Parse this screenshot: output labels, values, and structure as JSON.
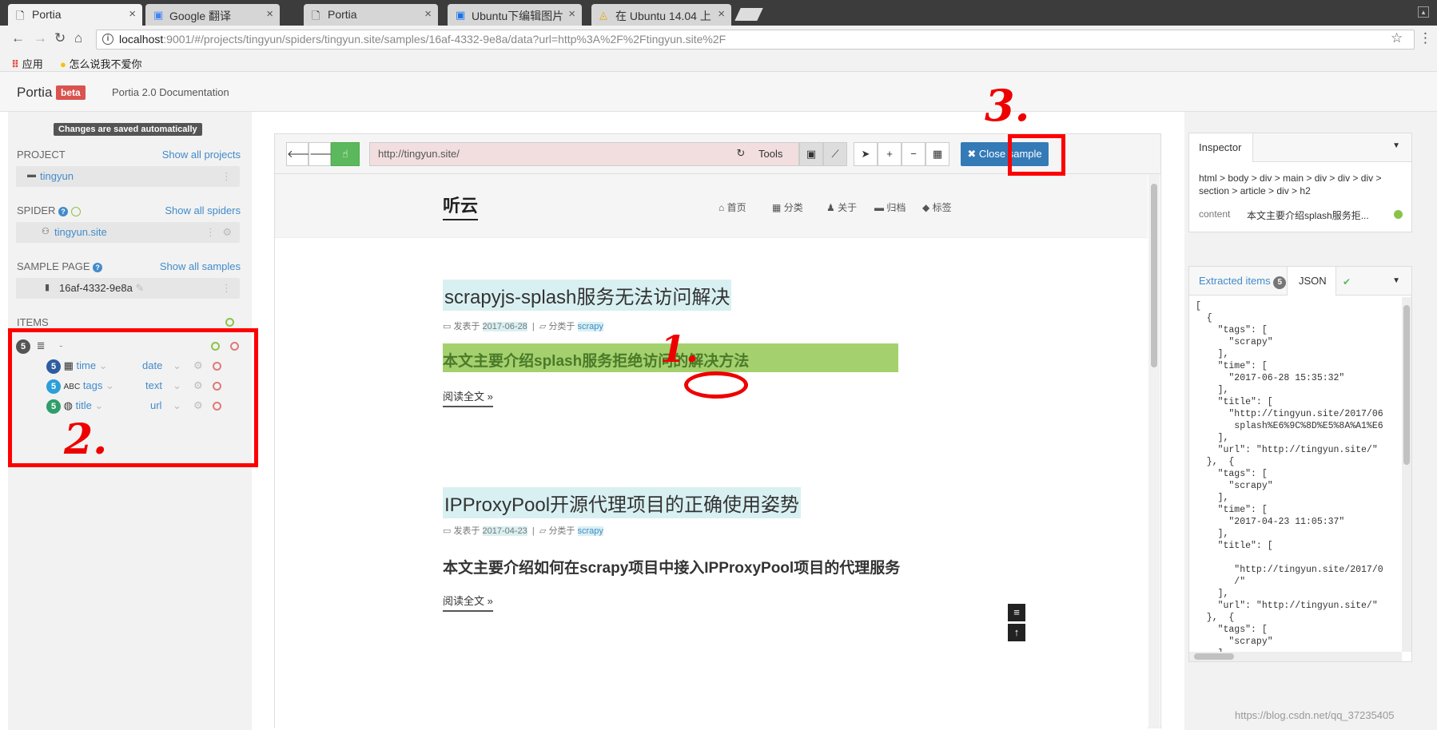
{
  "browser": {
    "tabs": [
      {
        "title": "Portia",
        "icon": "page-icon"
      },
      {
        "title": "Google 翻译",
        "icon": "google-translate-icon"
      },
      {
        "title": "Portia",
        "icon": "page-icon"
      },
      {
        "title": "Ubuntu下编辑图片",
        "icon": "ubuntu-icon"
      },
      {
        "title": "在 Ubuntu 14.04 上",
        "icon": "linux-icon"
      }
    ],
    "url_host": "localhost",
    "url_rest": ":9001/#/projects/tingyun/spiders/tingyun.site/samples/16af-4332-9e8a/data?url=http%3A%2F%2Ftingyun.site%2F",
    "bookmarks": [
      "应用",
      "怎么说我不爱你"
    ]
  },
  "portia": {
    "logo": "Portia",
    "beta": "beta",
    "doc_link": "Portia 2.0 Documentation"
  },
  "sidebar": {
    "saved_notice": "Changes are saved automatically",
    "project_label": "PROJECT",
    "project_link": "Show all projects",
    "project_name": "tingyun",
    "spider_label": "SPIDER",
    "spider_link": "Show all spiders",
    "spider_name": "tingyun.site",
    "sample_label": "SAMPLE PAGE",
    "sample_link": "Show all samples",
    "sample_name": "16af-4332-9e8a",
    "items_label": "ITEMS",
    "item_root": {
      "count": "5",
      "name": "-"
    },
    "fields": [
      {
        "count": "5",
        "icon": "calendar-icon",
        "name": "time",
        "type": "date",
        "badge_color": "#2e5d9f"
      },
      {
        "count": "5",
        "icon": "abc-icon",
        "name": "tags",
        "type": "text",
        "badge_color": "#2b9fd9"
      },
      {
        "count": "5",
        "icon": "globe-icon",
        "name": "title",
        "type": "url",
        "badge_color": "#2e9e6a"
      }
    ]
  },
  "toolbar": {
    "url": "http://tingyun.site/",
    "tools_label": "Tools",
    "close_label": "Close sample"
  },
  "site": {
    "logo": "听云",
    "nav": [
      "首页",
      "分类",
      "关于",
      "归档",
      "标签"
    ],
    "posts": [
      {
        "title": "scrapyjs-splash服务无法访问解决",
        "meta_pre": "发表于",
        "date": "2017-06-28",
        "meta_cat": "分类于",
        "category": "scrapy",
        "desc": "本文主要介绍splash服务拒绝访问的解决方法",
        "more": "阅读全文 »"
      },
      {
        "title": "IPProxyPool开源代理项目的正确使用姿势",
        "meta_pre": "发表于",
        "date": "2017-04-23",
        "meta_cat": "分类于",
        "category": "scrapy",
        "desc": "本文主要介绍如何在scrapy项目中接入IPProxyPool项目的代理服务",
        "more": "阅读全文 »"
      }
    ]
  },
  "inspector": {
    "title": "Inspector",
    "path": "html > body > div > main > div > div > div > section > article > div > h2",
    "attr_name": "content",
    "attr_value": "本文主要介绍splash服务拒..."
  },
  "extracted": {
    "tab_label": "Extracted items",
    "count": "5",
    "json_tab": "JSON",
    "json_text": "[\n  {\n    \"tags\": [\n      \"scrapy\"\n    ],\n    \"time\": [\n      \"2017-06-28 15:35:32\"\n    ],\n    \"title\": [\n      \"http://tingyun.site/2017/06\n       splash%E6%9C%8D%E5%8A%A1%E6\n    ],\n    \"url\": \"http://tingyun.site/\"\n  },  {\n    \"tags\": [\n      \"scrapy\"\n    ],\n    \"time\": [\n      \"2017-04-23 11:05:37\"\n    ],\n    \"title\": [\n\n       \"http://tingyun.site/2017/0\n       /\"\n    ],\n    \"url\": \"http://tingyun.site/\"\n  },  {\n    \"tags\": [\n      \"scrapy\"\n    ],"
  },
  "annotations": {
    "one": "1.",
    "two": "2.",
    "three": "3."
  },
  "watermark": "https://blog.csdn.net/qq_37235405"
}
